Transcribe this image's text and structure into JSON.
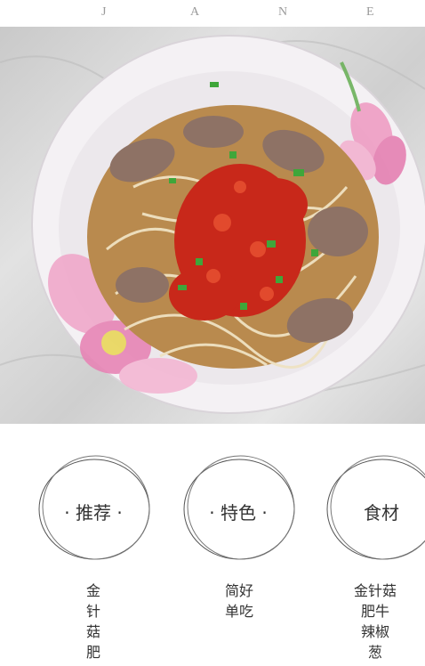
{
  "header": {
    "letters": [
      "J",
      "A",
      "N",
      "E"
    ]
  },
  "photo": {
    "description_icon": "noodle-bowl-photo",
    "colors": {
      "bowl": "#f4f1f4",
      "broth": "#b98a4e",
      "chili": "#c8281a",
      "scallion": "#3fa63a",
      "lotus": "#e98ab6"
    }
  },
  "cards": [
    {
      "label": "· 推荐 ·",
      "lines": [
        "金",
        "针",
        "菇",
        "肥"
      ]
    },
    {
      "label": "· 特色 ·",
      "lines": [
        "简好",
        "单吃"
      ]
    },
    {
      "label": "食材",
      "lines": [
        "金针菇",
        "肥牛",
        "辣椒",
        "葱"
      ]
    }
  ]
}
